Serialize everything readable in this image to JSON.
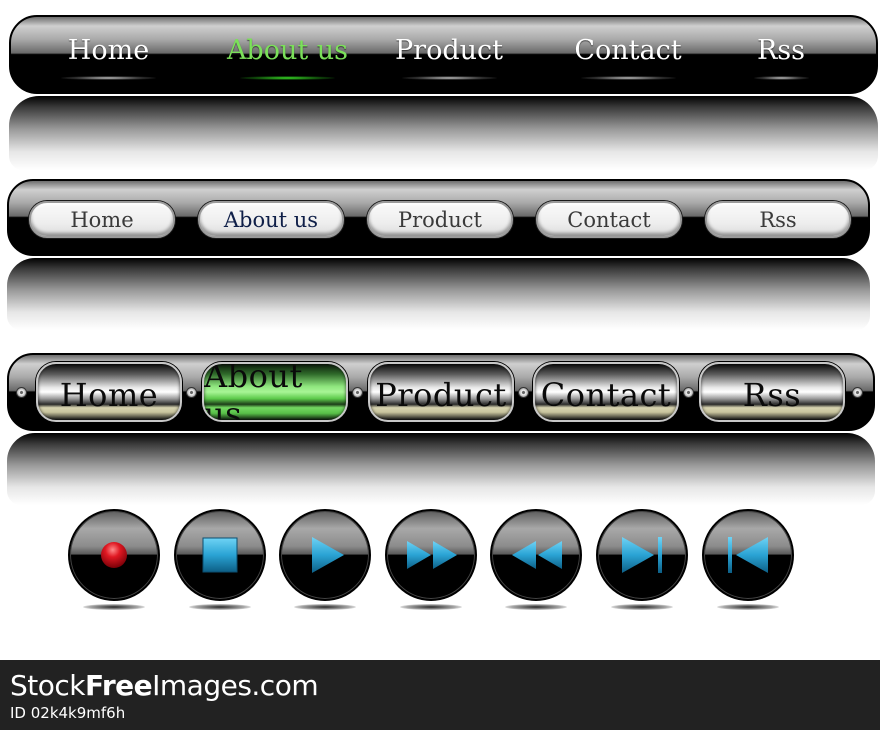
{
  "nav_bar_1": {
    "style": "glossy-black-glow",
    "items": [
      {
        "label": "Home",
        "active": false
      },
      {
        "label": "About us",
        "active": true
      },
      {
        "label": "Product",
        "active": false
      },
      {
        "label": "Contact",
        "active": false
      },
      {
        "label": "Rss",
        "active": false
      }
    ],
    "active_color": "#7be05a",
    "text_color": "#ffffff"
  },
  "nav_bar_2": {
    "style": "white-pills",
    "items": [
      {
        "label": "Home",
        "active": false
      },
      {
        "label": "About us",
        "active": true
      },
      {
        "label": "Product",
        "active": false
      },
      {
        "label": "Contact",
        "active": false
      },
      {
        "label": "Rss",
        "active": false
      }
    ],
    "active_color": "#0f1f48",
    "text_color": "#3a3a3a"
  },
  "nav_bar_3": {
    "style": "chrome-pills-with-rivets",
    "items": [
      {
        "label": "Home",
        "active": false
      },
      {
        "label": "About us",
        "active": true
      },
      {
        "label": "Product",
        "active": false
      },
      {
        "label": "Contact",
        "active": false
      },
      {
        "label": "Rss",
        "active": false
      }
    ],
    "active_color": "#8fe67e",
    "rivet_count": 6
  },
  "media_controls": [
    {
      "name": "record",
      "icon": "record-icon",
      "color": "#c8101a"
    },
    {
      "name": "stop",
      "icon": "stop-icon",
      "color": "#1e8fbf"
    },
    {
      "name": "play",
      "icon": "play-icon",
      "color": "#1e8fbf"
    },
    {
      "name": "fast-forward",
      "icon": "fast-forward-icon",
      "color": "#1e8fbf"
    },
    {
      "name": "rewind",
      "icon": "rewind-icon",
      "color": "#1e8fbf"
    },
    {
      "name": "skip-next",
      "icon": "skip-next-icon",
      "color": "#1e8fbf"
    },
    {
      "name": "skip-previous",
      "icon": "skip-previous-icon",
      "color": "#1e8fbf"
    }
  ],
  "footer": {
    "brand_prefix": "Stock",
    "brand_bold": "Free",
    "brand_suffix": "Images.com",
    "image_id": "ID 02k4k9mf6h"
  }
}
